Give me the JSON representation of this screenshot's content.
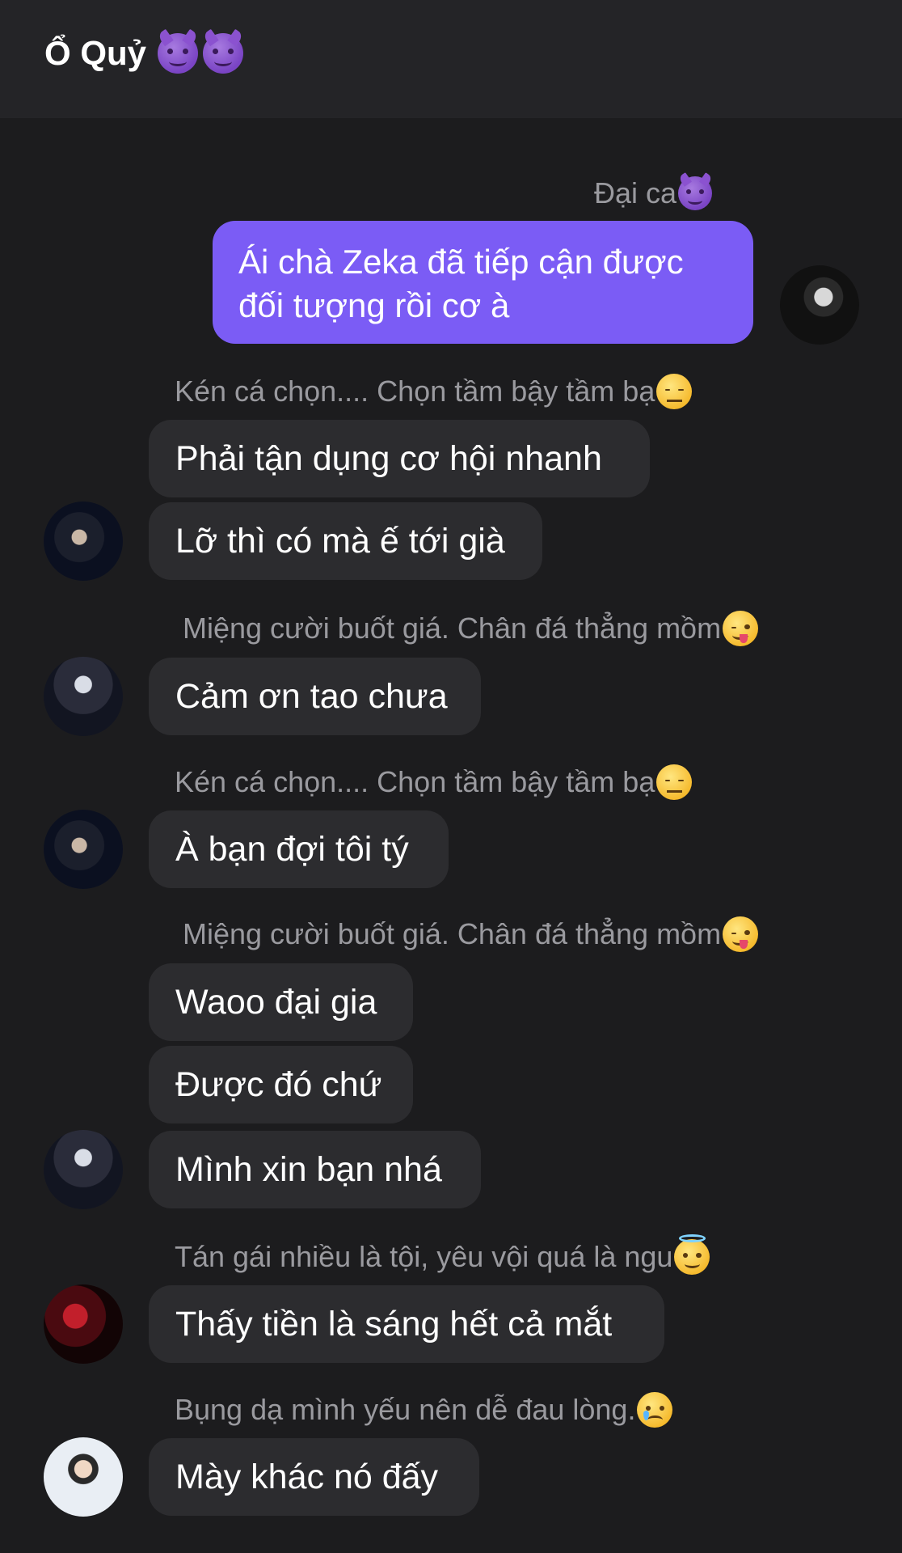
{
  "header": {
    "title": "Ổ Quỷ",
    "title_emojis": [
      "smiling-devil",
      "smiling-devil"
    ]
  },
  "messages": [
    {
      "sender": "Đại ca",
      "sender_emoji": "smiling-devil",
      "texts": [
        "Ái chà Zeka đã tiếp cận được đối tượng rồi cơ à"
      ],
      "mine": true
    },
    {
      "sender": "Kén cá chọn.... Chọn tầm bậy tầm bạ",
      "sender_emoji": "expressionless-face",
      "texts": [
        "Phải tận dụng cơ hội nhanh",
        "Lỡ thì có mà ế tới già"
      ]
    },
    {
      "sender": "Miệng cười buốt giá. Chân đá thẳng mồm",
      "sender_emoji": "winking-tongue-face",
      "texts": [
        "Cảm ơn tao chưa"
      ]
    },
    {
      "sender": "Kén cá chọn.... Chọn tầm bậy tầm bạ",
      "sender_emoji": "expressionless-face",
      "texts": [
        "À bạn đợi tôi tý"
      ]
    },
    {
      "sender": "Miệng cười buốt giá. Chân đá thẳng mồm",
      "sender_emoji": "winking-tongue-face",
      "texts": [
        "Waoo đại gia",
        "Được đó chứ",
        "Mình xin bạn nhá"
      ]
    },
    {
      "sender": "Tán gái nhiều là tội, yêu vội quá là ngu",
      "sender_emoji": "halo-face",
      "texts": [
        "Thấy tiền là sáng hết cả mắt"
      ]
    },
    {
      "sender": "Bụng dạ mình yếu nên dễ đau lòng.",
      "sender_emoji": "crying-face",
      "texts": [
        "Mày khác nó đấy"
      ]
    }
  ],
  "colors": {
    "background": "#1c1c1e",
    "header": "#242427",
    "bubble_theirs": "#2c2c2f",
    "bubble_mine": "#7b5cf5",
    "sender_text": "#9a9a9f"
  }
}
